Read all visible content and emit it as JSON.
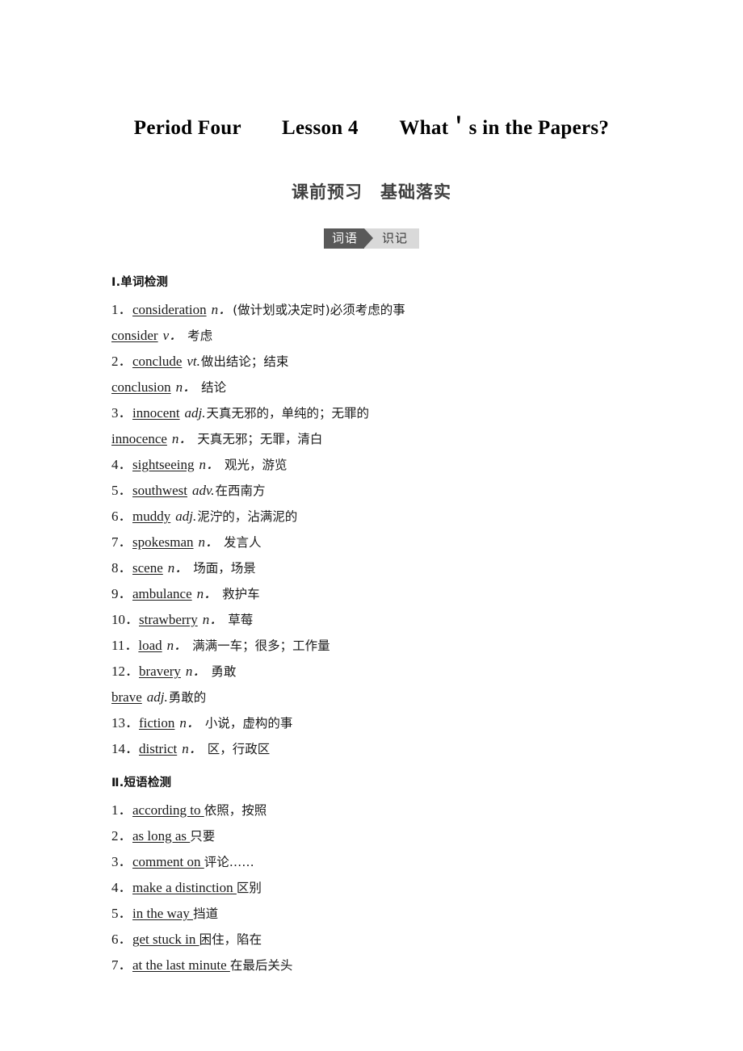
{
  "title": "Period Four　　Lesson 4　　What＇s in the Papers?",
  "subtitle": "课前预习　基础落实",
  "badge": {
    "left_label": "词语",
    "right_label": "识记",
    "dark_color": "#595959",
    "light_color": "#d9d9d9"
  },
  "sections": [
    {
      "heading": "Ⅰ.单词检测",
      "entries": [
        {
          "num": "1．",
          "term": "consideration",
          "pos": "n．",
          "gloss": "(做计划或决定时)必须考虑的事"
        },
        {
          "num": "",
          "term": "consider",
          "pos": "v．",
          "gloss": "考虑"
        },
        {
          "num": "2．",
          "term": "conclude",
          "pos": "vt.",
          "gloss": "做出结论；结束"
        },
        {
          "num": "",
          "term": "conclusion",
          "pos": "n．",
          "gloss": "结论"
        },
        {
          "num": "3．",
          "term": "innocent",
          "pos": "adj.",
          "gloss": "天真无邪的，单纯的；无罪的"
        },
        {
          "num": "",
          "term": "innocence",
          "pos": "n．",
          "gloss": "天真无邪；无罪，清白"
        },
        {
          "num": "4．",
          "term": "sightseeing",
          "pos": "n．",
          "gloss": "观光，游览"
        },
        {
          "num": "5．",
          "term": "southwest",
          "pos": "adv.",
          "gloss": "在西南方"
        },
        {
          "num": "6．",
          "term": "muddy",
          "pos": "adj.",
          "gloss": "泥泞的，沾满泥的"
        },
        {
          "num": "7．",
          "term": "spokesman",
          "pos": "n．",
          "gloss": "发言人"
        },
        {
          "num": "8．",
          "term": "scene",
          "pos": "n．",
          "gloss": "场面，场景"
        },
        {
          "num": "9．",
          "term": "ambulance",
          "pos": "n．",
          "gloss": "救护车"
        },
        {
          "num": "10．",
          "term": "strawberry",
          "pos": "n．",
          "gloss": "草莓"
        },
        {
          "num": "11．",
          "term": "load",
          "pos": "n．",
          "gloss": "满满一车；很多；工作量"
        },
        {
          "num": "12．",
          "term": "bravery",
          "pos": "n．",
          "gloss": "勇敢"
        },
        {
          "num": "",
          "term": "brave",
          "pos": "adj.",
          "gloss": "勇敢的"
        },
        {
          "num": "13．",
          "term": "fiction",
          "pos": "n．",
          "gloss": "小说，虚构的事"
        },
        {
          "num": "14．",
          "term": "district",
          "pos": "n．",
          "gloss": "区，行政区"
        }
      ]
    },
    {
      "heading": "Ⅱ.短语检测",
      "entries": [
        {
          "num": "1．",
          "term": "according to ",
          "pos": "",
          "gloss": "依照，按照"
        },
        {
          "num": "2．",
          "term": "as long as ",
          "pos": "",
          "gloss": "只要"
        },
        {
          "num": "3．",
          "term": "comment on ",
          "pos": "",
          "gloss": "评论……"
        },
        {
          "num": "4．",
          "term": "make a distinction ",
          "pos": "",
          "gloss": "区别"
        },
        {
          "num": "5．",
          "term": "in the way ",
          "pos": "",
          "gloss": "挡道"
        },
        {
          "num": "6．",
          "term": "get stuck in ",
          "pos": "",
          "gloss": "困住，陷在"
        },
        {
          "num": "7．",
          "term": "at the last minute ",
          "pos": "",
          "gloss": "在最后关头"
        }
      ]
    }
  ]
}
